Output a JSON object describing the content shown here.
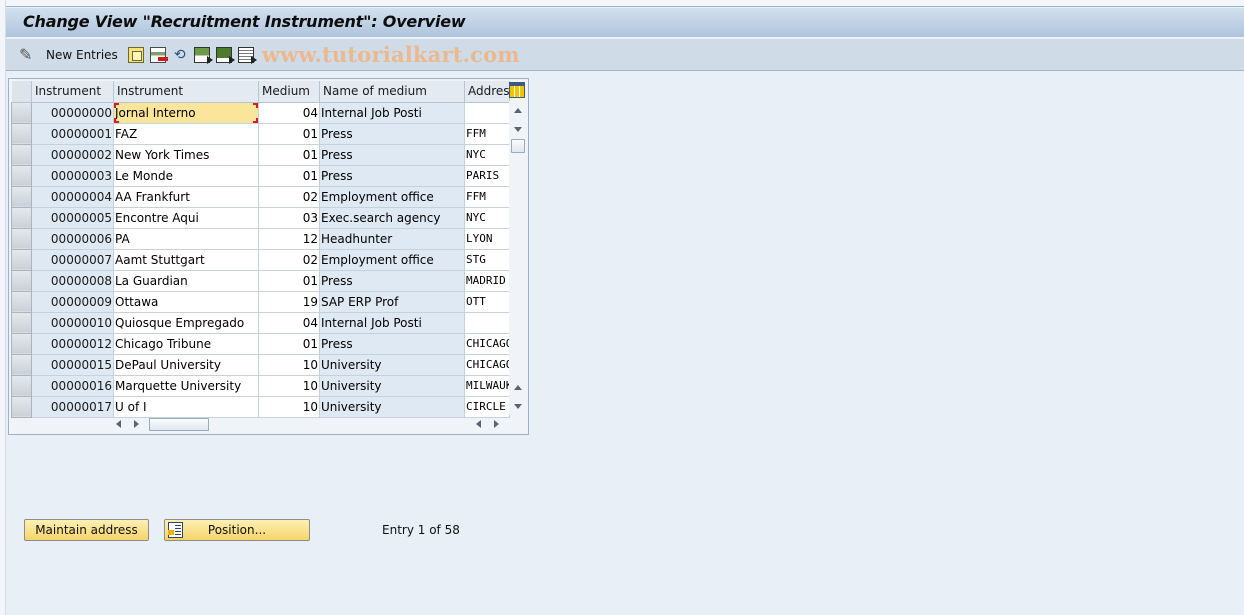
{
  "window": {
    "title": "Change View \"Recruitment Instrument\": Overview"
  },
  "toolbar": {
    "new_entries_label": "New Entries",
    "icons": [
      "edit-pencil-icon",
      "copy-as-icon",
      "delete-icon",
      "undo-change-icon",
      "select-all-icon",
      "select-block-icon",
      "deselect-all-icon"
    ],
    "watermark": "www.tutorialkart.com"
  },
  "table": {
    "columns": [
      "Instrument",
      "Instrument",
      "Medium",
      "Name of medium",
      "Address"
    ],
    "focused_row": 0,
    "rows": [
      {
        "id": "00000000",
        "name": "Jornal Interno",
        "medium": "04",
        "medium_name": "Internal Job Posti",
        "address": ""
      },
      {
        "id": "00000001",
        "name": "FAZ",
        "medium": "01",
        "medium_name": "Press",
        "address": "FFM"
      },
      {
        "id": "00000002",
        "name": "New York Times",
        "medium": "01",
        "medium_name": "Press",
        "address": "NYC"
      },
      {
        "id": "00000003",
        "name": "Le Monde",
        "medium": "01",
        "medium_name": "Press",
        "address": "PARIS"
      },
      {
        "id": "00000004",
        "name": "AA Frankfurt",
        "medium": "02",
        "medium_name": "Employment office",
        "address": "FFM"
      },
      {
        "id": "00000005",
        "name": "Encontre Aqui",
        "medium": "03",
        "medium_name": "Exec.search agency",
        "address": "NYC"
      },
      {
        "id": "00000006",
        "name": "PA",
        "medium": "12",
        "medium_name": "Headhunter",
        "address": "LYON"
      },
      {
        "id": "00000007",
        "name": "Aamt Stuttgart",
        "medium": "02",
        "medium_name": "Employment office",
        "address": "STG"
      },
      {
        "id": "00000008",
        "name": "La Guardian",
        "medium": "01",
        "medium_name": "Press",
        "address": "MADRID"
      },
      {
        "id": "00000009",
        "name": "Ottawa",
        "medium": "19",
        "medium_name": "SAP ERP Prof",
        "address": " OTT"
      },
      {
        "id": "00000010",
        "name": "Quiosque Empregado",
        "medium": "04",
        "medium_name": "Internal Job Posti",
        "address": ""
      },
      {
        "id": "00000012",
        "name": "Chicago Tribune",
        "medium": "01",
        "medium_name": "Press",
        "address": "CHICAGO"
      },
      {
        "id": "00000015",
        "name": "DePaul University",
        "medium": "10",
        "medium_name": "University",
        "address": "CHICAGO"
      },
      {
        "id": "00000016",
        "name": "Marquette University",
        "medium": "10",
        "medium_name": "University",
        "address": "MILWAUKEE"
      },
      {
        "id": "00000017",
        "name": "U of I",
        "medium": "10",
        "medium_name": "University",
        "address": "CIRCLE"
      }
    ]
  },
  "footer": {
    "maintain_address_label": "Maintain address",
    "position_label": "Position...",
    "entry_info": "Entry 1 of 58"
  },
  "colors": {
    "title_gradient_top": "#d3e0ed",
    "title_gradient_bottom": "#aec4dc",
    "toolbar_bg": "#cfdce7",
    "focus_cell": "#fbe59a",
    "button_bg": "#f6d46a",
    "watermark": "#ebb990"
  }
}
